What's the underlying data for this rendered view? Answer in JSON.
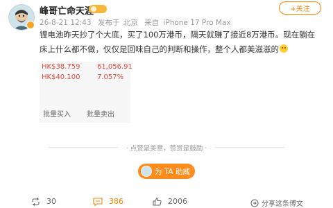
{
  "author": {
    "name": "峰哥亡命天涯",
    "date": "26-8-21 12:43",
    "posted_from_label": "发布于",
    "location": "北京",
    "source_prefix": "来自",
    "device": "iPhone 17 Pro Max"
  },
  "follow_label": "+关注",
  "post": {
    "text": "锂电池昨天抄了个大底，买了100万港币，隔天就赚了接近8万港币。现在躺在床上什么都不做，仅仅是回味自己的判断和操作，整个人都美滋滋的"
  },
  "stock_card": {
    "price_1": "HK$38.759",
    "value_1": "61,056.91",
    "price_2": "HK$40.100",
    "value_2": "7.057%",
    "buy_label": "批量买入",
    "sell_label": "批量卖出"
  },
  "appreciation": {
    "divider_text": "点赞是美意，赞赏是鼓励",
    "tip_button_label": "为 TA 助威"
  },
  "actions": {
    "repost_count": "30",
    "comment_count": "386",
    "like_count": "2006",
    "share_label": "分享这条博文"
  }
}
